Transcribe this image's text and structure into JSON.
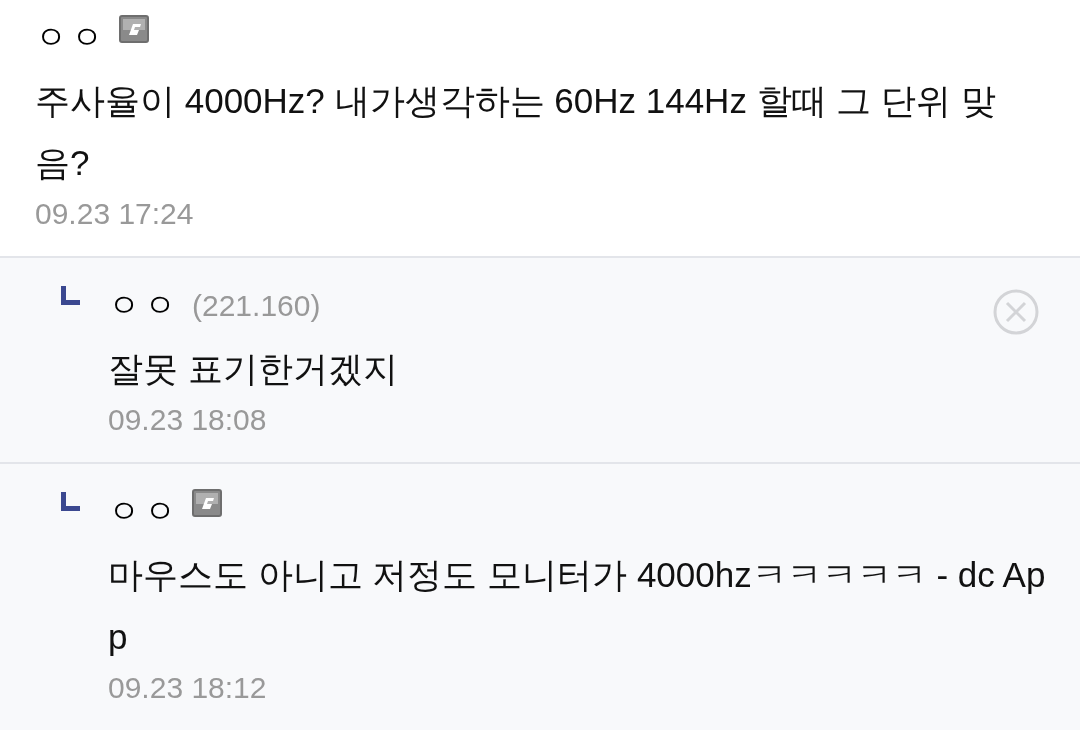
{
  "comments": [
    {
      "kind": "comment",
      "name": "ㅇㅇ",
      "badge": true,
      "deletable": false,
      "text": "주사율이 4000Hz? 내가생각하는 60Hz 144Hz 할때 그 단위 맞음?",
      "time": "09.23 17:24"
    },
    {
      "kind": "reply",
      "name": "ㅇㅇ",
      "badge": false,
      "ip": "(221.160)",
      "deletable": true,
      "text": "잘못 표기한거겠지",
      "time": "09.23 18:08"
    },
    {
      "kind": "reply",
      "name": "ㅇㅇ",
      "badge": true,
      "deletable": false,
      "text": "마우스도 아니고 저정도 모니터가 4000hzㅋㅋㅋㅋㅋ - dc App",
      "time": "09.23 18:12"
    }
  ]
}
